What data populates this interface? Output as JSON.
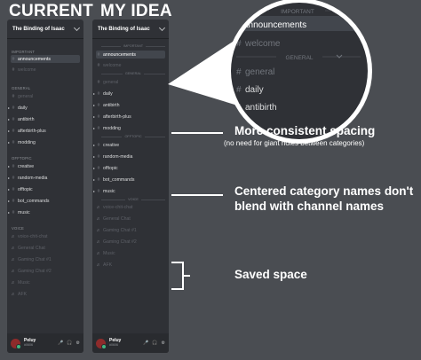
{
  "headings": {
    "current": "CURRENT",
    "idea": "MY IDEA"
  },
  "current": {
    "server_name": "The Binding of Isaac",
    "categories": {
      "important": "IMPORTANT",
      "general": "GENERAL",
      "offtopic": "OFFTOPIC",
      "voice": "VOICE"
    },
    "channels": {
      "announcements": "announcements",
      "welcome": "welcome",
      "general": "general",
      "daily": "daily",
      "antibirth": "antibirth",
      "afterbirth_plus": "afterbirth-plus",
      "modding": "modding",
      "creative": "creative",
      "random_media": "random-media",
      "offtopic": "offtopic",
      "bot_commands": "bot_commands",
      "music": "music",
      "voice_chit_chat": "voice-chit-chat",
      "general_chat": "General Chat",
      "gaming_chat_1": "Gaming Chat #1",
      "gaming_chat_2": "Gaming Chat #2",
      "music_voice": "Music",
      "afk": "AFK"
    },
    "user": {
      "name": "Peluy",
      "status": "#0606"
    }
  },
  "idea": {
    "server_name": "The Binding of Isaac",
    "categories": {
      "important": "IMPORTANT",
      "general": "GENERAL",
      "offtopic": "OFFTOPIC",
      "voice": "VOICE"
    },
    "channels": {
      "announcements": "announcements",
      "welcome": "welcome",
      "general": "general",
      "daily": "daily",
      "antibirth": "antibirth",
      "afterbirth_plus": "afterbirth-plus",
      "modding": "modding",
      "creative": "creative",
      "random_media": "random-media",
      "offtopic": "offtopic",
      "bot_commands": "bot_commands",
      "music": "music",
      "voice_chit_chat": "voice-chit-chat",
      "general_chat": "General Chat",
      "gaming_chat_1": "Gaming Chat #1",
      "gaming_chat_2": "Gaming Chat #2",
      "music_voice": "Music",
      "afk": "AFK"
    },
    "user": {
      "name": "Peluy",
      "status": "#0606"
    }
  },
  "zoom": {
    "important": "IMPORTANT",
    "announcements": "announcements",
    "welcome": "welcome",
    "general_cat": "GENERAL",
    "general": "general",
    "daily": "daily",
    "antibirth": "antibirth"
  },
  "callouts": {
    "spacing_title": "More consistent spacing",
    "spacing_sub": "(no need for giant holes between categories)",
    "centered_line1": "Centered category names don't",
    "centered_line2": "blend with channel names",
    "saved": "Saved space"
  },
  "colors": {
    "background": "#4a4d52",
    "panel": "#2f3136",
    "user_bar": "#292b2f",
    "online": "#43b581"
  }
}
